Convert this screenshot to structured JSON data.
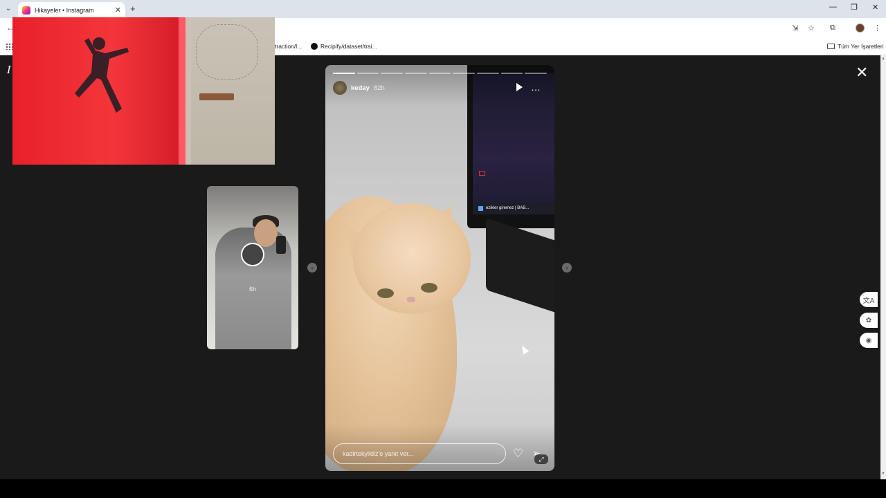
{
  "browser": {
    "tab_title": "Hikayeler • Instagram",
    "tab_close": "✕",
    "new_tab": "+",
    "window_controls": [
      "—",
      "❐",
      "✕"
    ],
    "back": "←"
  },
  "bookmarks": {
    "items": [
      {
        "label": "traction/l..."
      },
      {
        "label": "Recipify/dataset/trai..."
      }
    ],
    "all_bookmarks": "Tüm Yer İşaretleri"
  },
  "instagram": {
    "logo_letter": "I"
  },
  "prev_story": {
    "time": "6h"
  },
  "story": {
    "segments_total": 9,
    "segments_active": 1,
    "username": "keday",
    "time": "82h",
    "taskbar_text": "ezikler giremez | BAB...",
    "reply_placeholder": "kadirtekyildiz'e yanıt ver...",
    "play_icon": "play-icon",
    "more_icon": "…"
  },
  "nav": {
    "prev": "‹",
    "next": "›"
  },
  "close": "✕",
  "side_extensions": [
    "文A",
    "✿",
    "◉"
  ]
}
